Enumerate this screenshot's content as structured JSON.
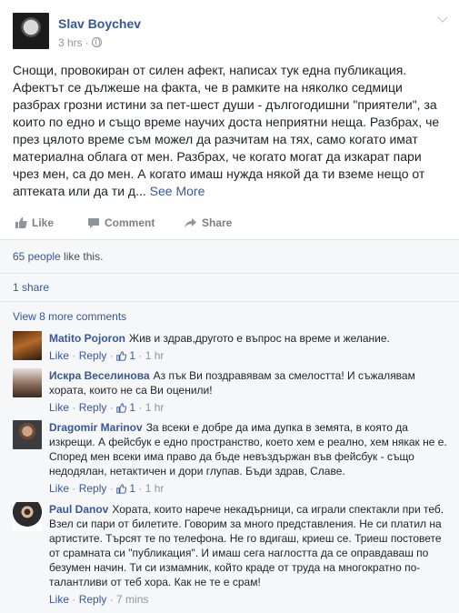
{
  "post": {
    "author": "Slav Boychev",
    "time": "3 hrs",
    "text": "Снощи, провокиран от силен афект, написах тук една публикация. Афектът се дължеше на факта, че в рамките на няколко седмици разбрах грозни истини за пет-шест души - дългогодишни \"приятели\", за които по едно и също време научих доста неприятни неща. Разбрах, че през цялото време съм можел да разчитам на тях, само когато имат материална облага от мен. Разбрах, че когато могат да изкарат пари чрез мен, са до мен. А когато имаш нужда някой да ти вземе нещо от аптеката или да ти д...",
    "see_more": "See More",
    "actions": {
      "like": "Like",
      "comment": "Comment",
      "share": "Share"
    },
    "likes_count": "65 people",
    "likes_suffix": " like this.",
    "shares": "1 share",
    "view_more": "View 8 more comments"
  },
  "comments": [
    {
      "name": "Matito Pojoron",
      "text": "Жив и здрав,другото е въпрос на време и желание.",
      "like": "Like",
      "reply": "Reply",
      "likes": "1",
      "time": "1 hr"
    },
    {
      "name": "Искра Веселинова",
      "text": "Аз пък Ви поздравявам за смелостта! И съжалявам хората, които не са Ви оценили!",
      "like": "Like",
      "reply": "Reply",
      "likes": "1",
      "time": "1 hr"
    },
    {
      "name": "Dragomir Marinov",
      "text": "За всеки е добре да има дупка в земята, в която да изкрещи. А фейсбук е едно пространство, което хем е реално, хем някак не е. Според мен всеки има право да бъде невъздържан във фейсбук - също недодялан, нетактичен и дори глупав. Бъди здрав, Славе.",
      "like": "Like",
      "reply": "Reply",
      "likes": "1",
      "time": "1 hr"
    },
    {
      "name": "Paul Danov",
      "text": "Хората, които нарече некадърници, са играли спектакли при теб. Взел си пари от билетите. Говорим за много представления. Не си платил на артистите. Търсят те по телефона. Не го вдигаш, криеш се. Триеш постовете от срамната си \"публикация\". И имаш сега наглостта да се оправдаваш по безумен начин. Ти си измамник, който краде от труда на многократно по-талантливи от теб хора. Как не те е срам!",
      "like": "Like",
      "reply": "Reply",
      "time": "7 mins"
    }
  ],
  "colors": {
    "link": "#365899",
    "meta": "#90949c",
    "panel": "#f6f7f9"
  }
}
